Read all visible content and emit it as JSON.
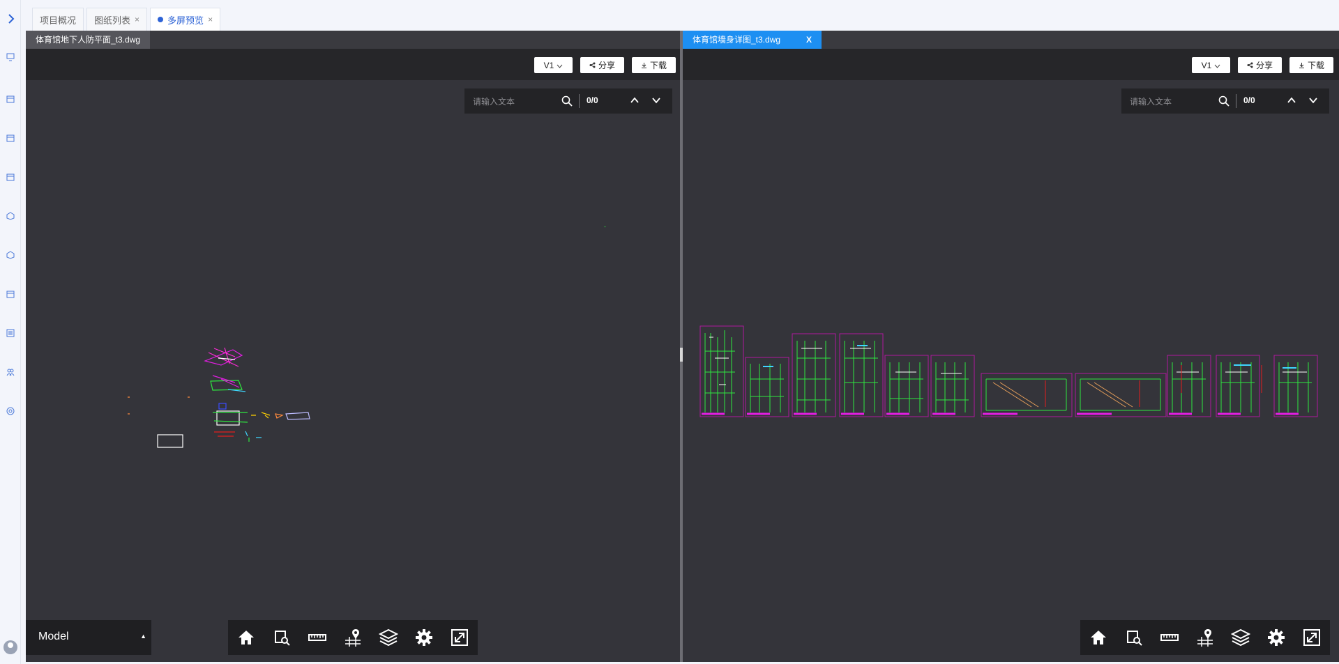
{
  "nav": {
    "expand_icon": "chevron-right-icon"
  },
  "tabs": [
    {
      "label": "项目概况",
      "closable": false
    },
    {
      "label": "图纸列表",
      "closable": true
    },
    {
      "label": "多屏预览",
      "closable": true,
      "active": true
    }
  ],
  "tab_close": "×",
  "left_viewer": {
    "file_name": "体育馆地下人防平面_t3.dwg",
    "version": "V1",
    "share": "分享",
    "download": "下载",
    "search_placeholder": "请输入文本",
    "search_count": "0/0",
    "layout_tab": "Model"
  },
  "right_viewer": {
    "file_name": "体育馆墙身详图_t3.dwg",
    "close": "X",
    "version": "V1",
    "share": "分享",
    "download": "下载",
    "search_placeholder": "请输入文本",
    "search_count": "0/0"
  },
  "bottom_tools": [
    "home-icon",
    "zoom-window-icon",
    "measure-ruler-icon",
    "location-pin-icon",
    "layers-icon",
    "settings-gear-icon",
    "fullscreen-icon"
  ],
  "colors": {
    "canvas": "#34343a",
    "toolbar": "#262629",
    "accent": "#2d63d6",
    "active_file_tab": "#1d8ff2"
  }
}
